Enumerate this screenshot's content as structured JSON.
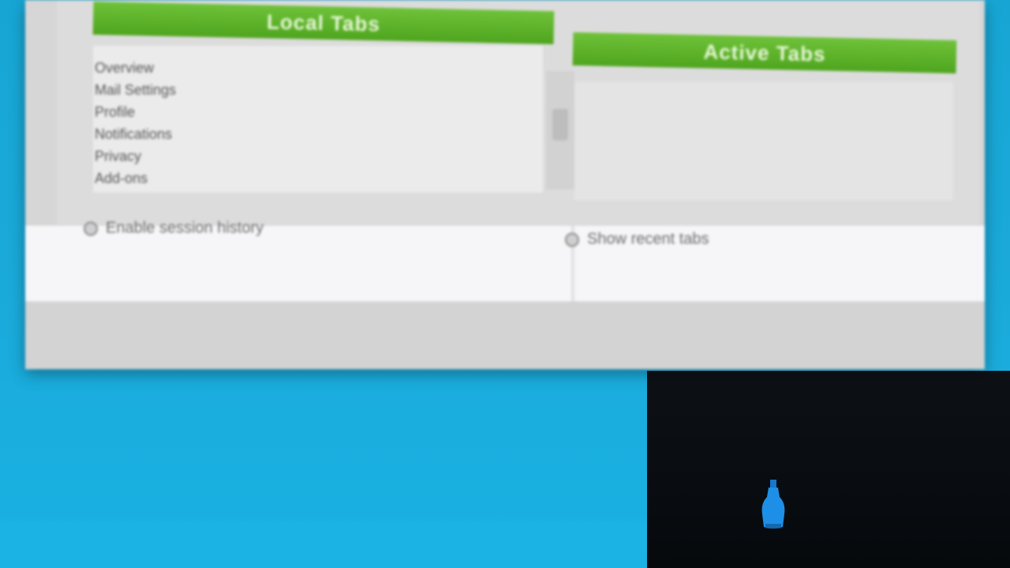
{
  "window": {
    "left_header": "Local Tabs",
    "right_header": "Active Tabs",
    "list_items": [
      "Overview",
      "Mail Settings",
      "Profile",
      "Notifications",
      "Privacy",
      "Add-ons"
    ],
    "left_option": "Enable session history",
    "right_option": "Show recent tabs",
    "colors": {
      "header_green": "#4ea51d",
      "panel_grey": "#d6d6d6",
      "desktop_blue": "#19b2e3"
    }
  },
  "desktop": {
    "icons": [
      "bottle-icon"
    ]
  }
}
